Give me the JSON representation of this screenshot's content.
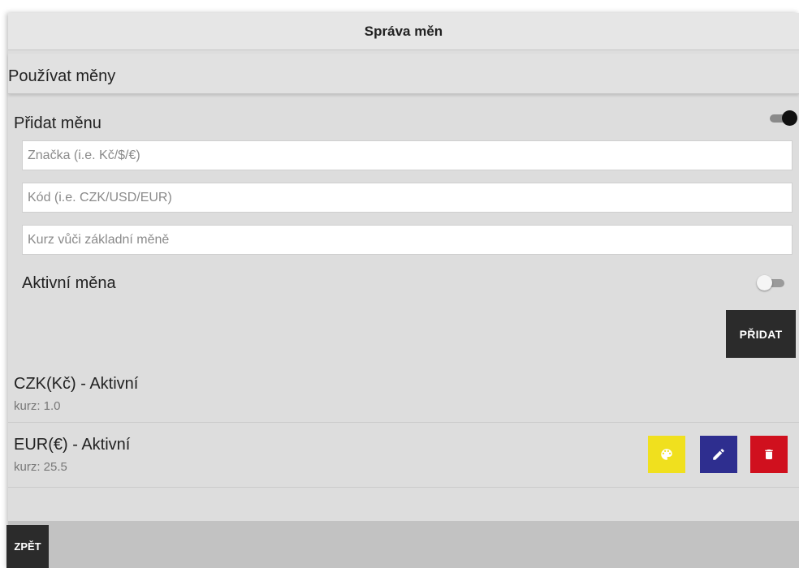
{
  "header": {
    "title": "Správa měn"
  },
  "settings": {
    "use_currencies_label": "Používat měny",
    "use_currencies_enabled": true
  },
  "add_form": {
    "section_title": "Přidat měnu",
    "symbol_placeholder": "Značka (i.e. Kč/$/€)",
    "symbol_value": "",
    "code_placeholder": "Kód (i.e. CZK/USD/EUR)",
    "code_value": "",
    "rate_placeholder": "Kurz vůči základní měně",
    "rate_value": "",
    "active_label": "Aktivní měna",
    "active_enabled": false,
    "add_button_label": "PŘIDAT"
  },
  "currencies": [
    {
      "name": "CZK(Kč) - Aktivní",
      "rate": "kurz: 1.0",
      "actions": []
    },
    {
      "name": "EUR(€) - Aktivní",
      "rate": "kurz: 25.5",
      "actions": [
        "palette-icon",
        "pencil-icon",
        "trash-icon"
      ]
    }
  ],
  "colors": {
    "color_button": "#f0e01e",
    "edit_button": "#2e2e8f",
    "delete_button": "#d0101e",
    "dark_button": "#2b2b2b",
    "panel": "#dddddd"
  },
  "footer": {
    "back_button_label": "ZPĚT"
  }
}
